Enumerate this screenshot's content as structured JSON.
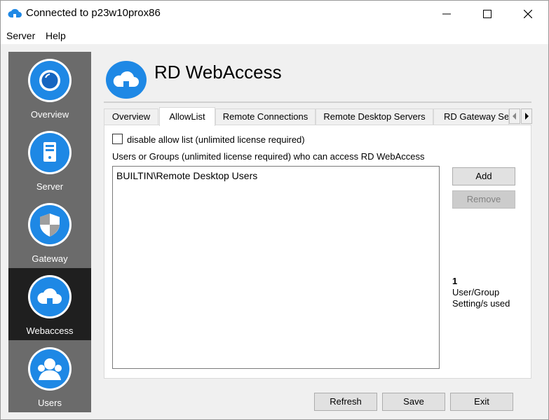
{
  "window": {
    "title": "Connected to p23w10prox86"
  },
  "menu": {
    "server": "Server",
    "help": "Help"
  },
  "sidebar": {
    "items": [
      {
        "label": "Overview",
        "icon": "overview-icon"
      },
      {
        "label": "Server",
        "icon": "server-icon"
      },
      {
        "label": "Gateway",
        "icon": "shield-icon"
      },
      {
        "label": "Webaccess",
        "icon": "cloud-icon",
        "active": true
      },
      {
        "label": "Users",
        "icon": "users-icon"
      }
    ]
  },
  "header": {
    "title": "RD WebAccess",
    "icon": "cloud-icon"
  },
  "tabs": [
    "Overview",
    "AllowList",
    "Remote Connections",
    "Remote Desktop Servers",
    "RD Gateway Ser"
  ],
  "active_tab": "AllowList",
  "allowlist": {
    "disable_label": "disable allow list (unlimited license required)",
    "disable_checked": false,
    "users_label": "Users or Groups (unlimited license required) who can access RD WebAccess",
    "entries": [
      "BUILTIN\\Remote Desktop Users"
    ],
    "add_label": "Add",
    "remove_label": "Remove",
    "count": "1",
    "count_label_1": "User/Group",
    "count_label_2": "Setting/s used"
  },
  "footer": {
    "refresh_label": "Refresh",
    "save_label": "Save",
    "exit_label": "Exit"
  },
  "colors": {
    "accent": "#1e88e5",
    "sidebar": "#6b6b6b",
    "sidebar_active": "#1f1f1f"
  }
}
